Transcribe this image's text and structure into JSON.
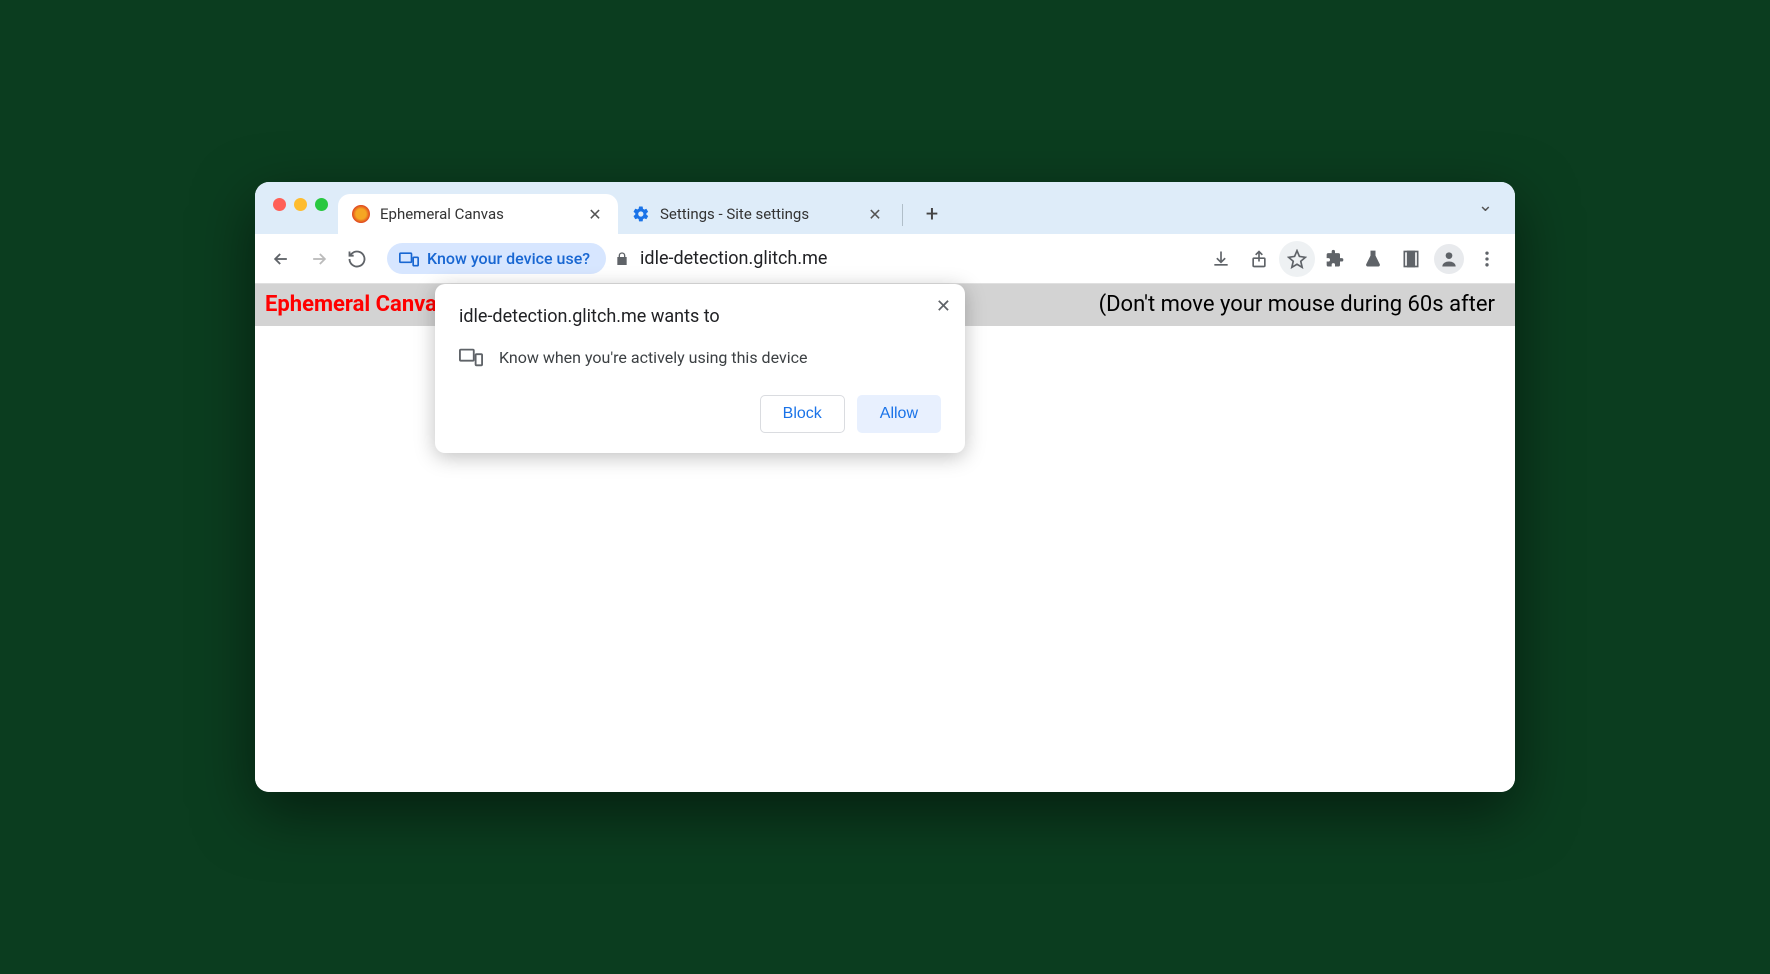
{
  "tabs": [
    {
      "title": "Ephemeral Canvas"
    },
    {
      "title": "Settings - Site settings"
    }
  ],
  "toolbar": {
    "permission_chip": "Know your device use?",
    "url": "idle-detection.glitch.me"
  },
  "page": {
    "title": "Ephemeral Canvas",
    "note": "(Don't move your mouse during 60s after"
  },
  "permission_popup": {
    "title": "idle-detection.glitch.me wants to",
    "row": "Know when you're actively using this device",
    "block": "Block",
    "allow": "Allow"
  }
}
